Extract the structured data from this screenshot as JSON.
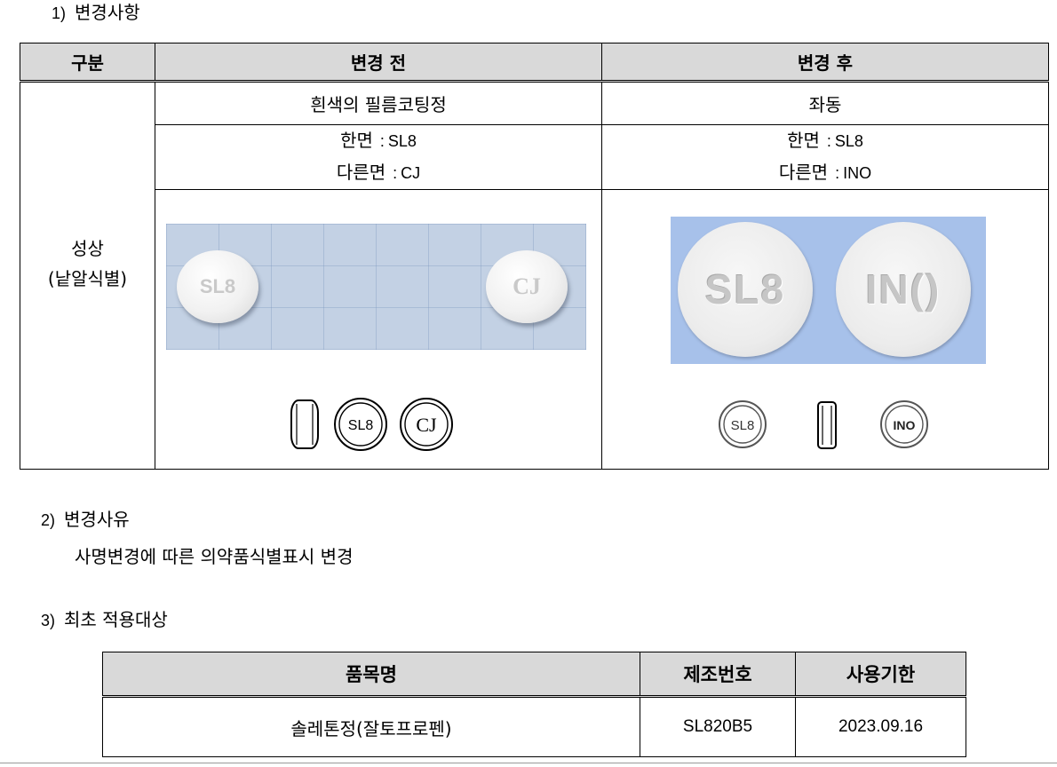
{
  "section1": {
    "num": "1)",
    "title": "변경사항"
  },
  "table1": {
    "headers": [
      "구분",
      "변경 전",
      "변경 후"
    ],
    "category_line1": "성상",
    "category_line2": "(낱알식별)",
    "before": {
      "appearance": "흰색의 필름코팅정",
      "side1_label": "한면",
      "side1_value": "SL8",
      "side2_label": "다른면",
      "side2_value": "CJ",
      "photo_marks": [
        "SL8",
        "CJ"
      ],
      "diagram_marks": [
        "SL8",
        "CJ"
      ]
    },
    "after": {
      "appearance": "좌동",
      "side1_label": "한면",
      "side1_value": "SL8",
      "side2_label": "다른면",
      "side2_value": "INO",
      "photo_marks": [
        "SL8",
        "IN()"
      ],
      "diagram_marks": [
        "SL8",
        "INO"
      ]
    }
  },
  "section2": {
    "num": "2)",
    "title": "변경사유",
    "body": "사명변경에 따른 의약품식별표시 변경"
  },
  "section3": {
    "num": "3)",
    "title": "최초 적용대상"
  },
  "table2": {
    "headers": [
      "품목명",
      "제조번호",
      "사용기한"
    ],
    "rows": [
      {
        "product": "솔레톤정(잘토프로펜)",
        "lot": "SL820B5",
        "expiry": "2023.09.16"
      }
    ]
  }
}
